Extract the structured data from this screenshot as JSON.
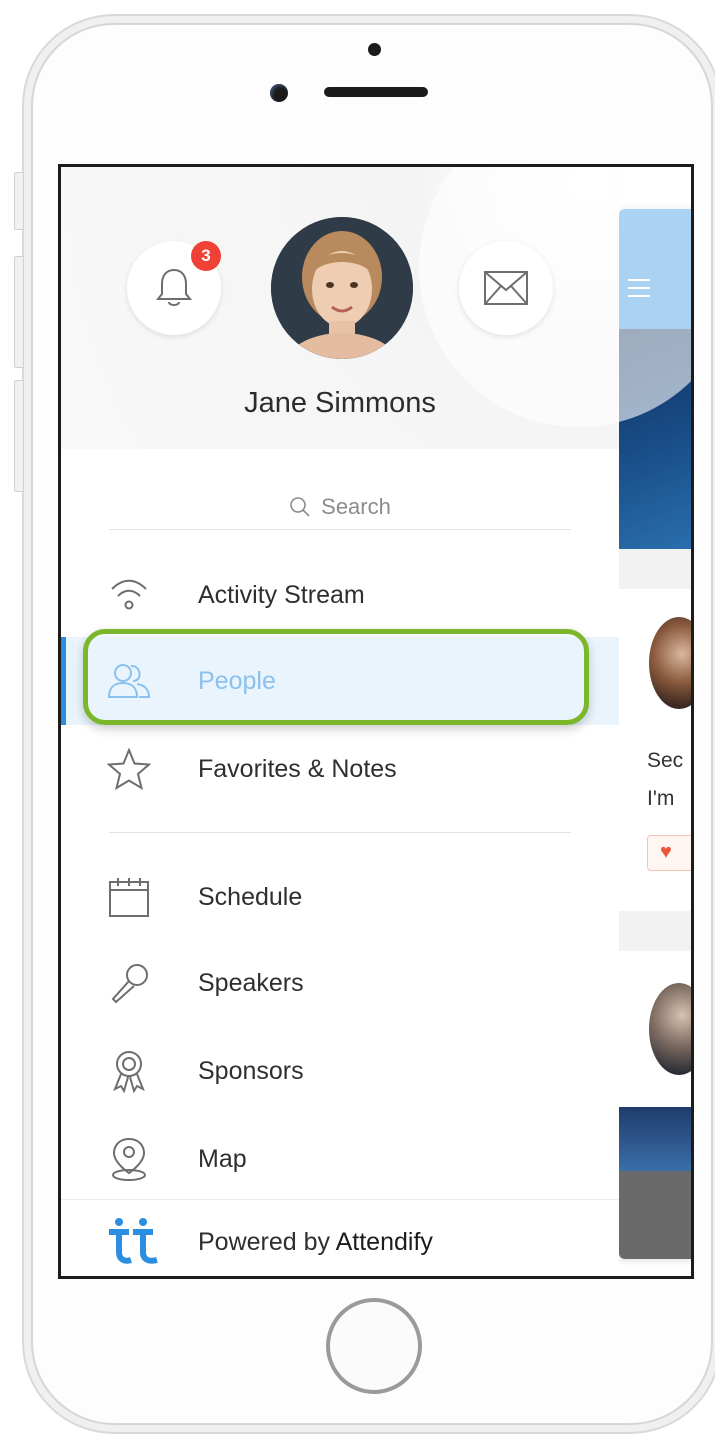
{
  "drawer": {
    "notification_count": "3",
    "user_name": "Jane Simmons",
    "search_placeholder": "Search",
    "menu": [
      {
        "label": "Activity Stream",
        "icon": "wifi-icon",
        "active": false
      },
      {
        "label": "People",
        "icon": "people-icon",
        "active": true
      },
      {
        "label": "Favorites & Notes",
        "icon": "star-icon",
        "active": false
      },
      {
        "label": "Schedule",
        "icon": "calendar-icon",
        "active": false
      },
      {
        "label": "Speakers",
        "icon": "microphone-icon",
        "active": false
      },
      {
        "label": "Sponsors",
        "icon": "ribbon-icon",
        "active": false
      },
      {
        "label": "Map",
        "icon": "map-pin-icon",
        "active": false
      }
    ],
    "footer": {
      "powered_by": "Powered by",
      "brand": "Attendify"
    }
  },
  "behind_screen": {
    "text_line_1": "Sec",
    "text_line_2": "I'm"
  },
  "colors": {
    "accent": "#2b8ee0",
    "badge": "#ef4136",
    "highlight_border": "#7cb62a",
    "active_bg": "#e9f4fc"
  }
}
